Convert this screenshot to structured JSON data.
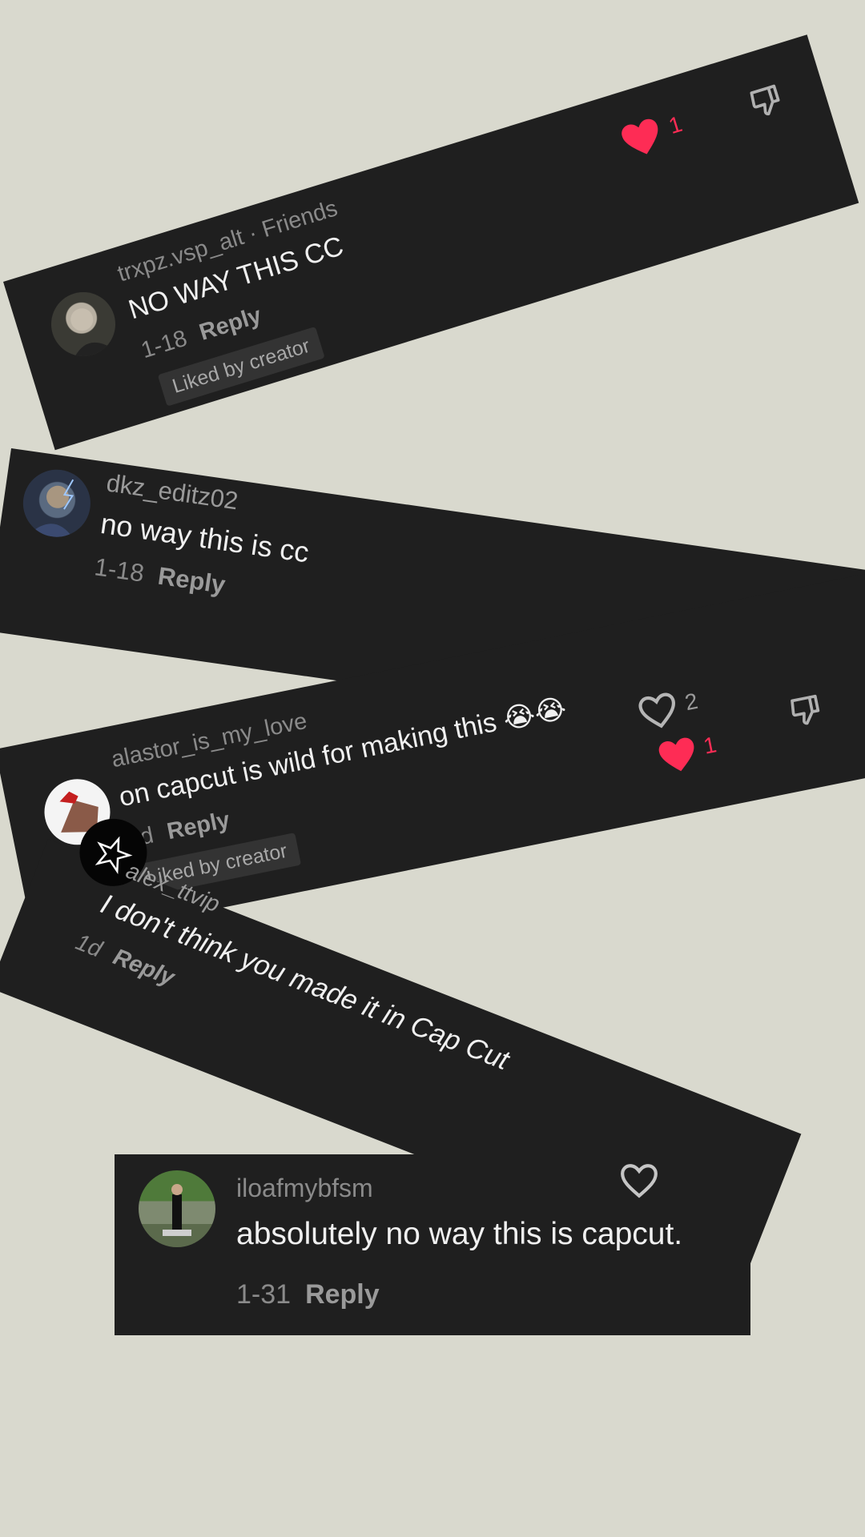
{
  "comments": [
    {
      "username": "trxpz.vsp_alt · Friends",
      "text": "NO WAY THIS CC",
      "date": "1-18",
      "reply": "Reply",
      "badge": "Liked by creator",
      "likes": "1",
      "liked": true,
      "avatar_icon": "man-portrait-avatar"
    },
    {
      "username": "dkz_editz02",
      "text": "no way this is cc",
      "date": "1-18",
      "reply": "Reply",
      "avatar_icon": "hero-avatar"
    },
    {
      "username": "alastor_is_my_love",
      "text": "on capcut is wild for making this 😭😭",
      "date": "4d",
      "reply": "Reply",
      "badge": "Liked by creator",
      "likes": "2",
      "creator_likes": "1",
      "avatar_icon": "character-avatar"
    },
    {
      "username": "alex_ttvip",
      "text": "I don't think you made it in Cap Cut",
      "date": "1d",
      "reply": "Reply",
      "avatar_icon": "star-avatar"
    },
    {
      "username": "iloafmybfsm",
      "text": "absolutely no way this is capcut.",
      "date": "1-31",
      "reply": "Reply",
      "avatar_icon": "person-standing-avatar"
    }
  ],
  "colors": {
    "background": "#d9d9ce",
    "card": "#1f1f1f",
    "heart_red": "#fe2c55",
    "muted_text": "#8a8a8a"
  }
}
